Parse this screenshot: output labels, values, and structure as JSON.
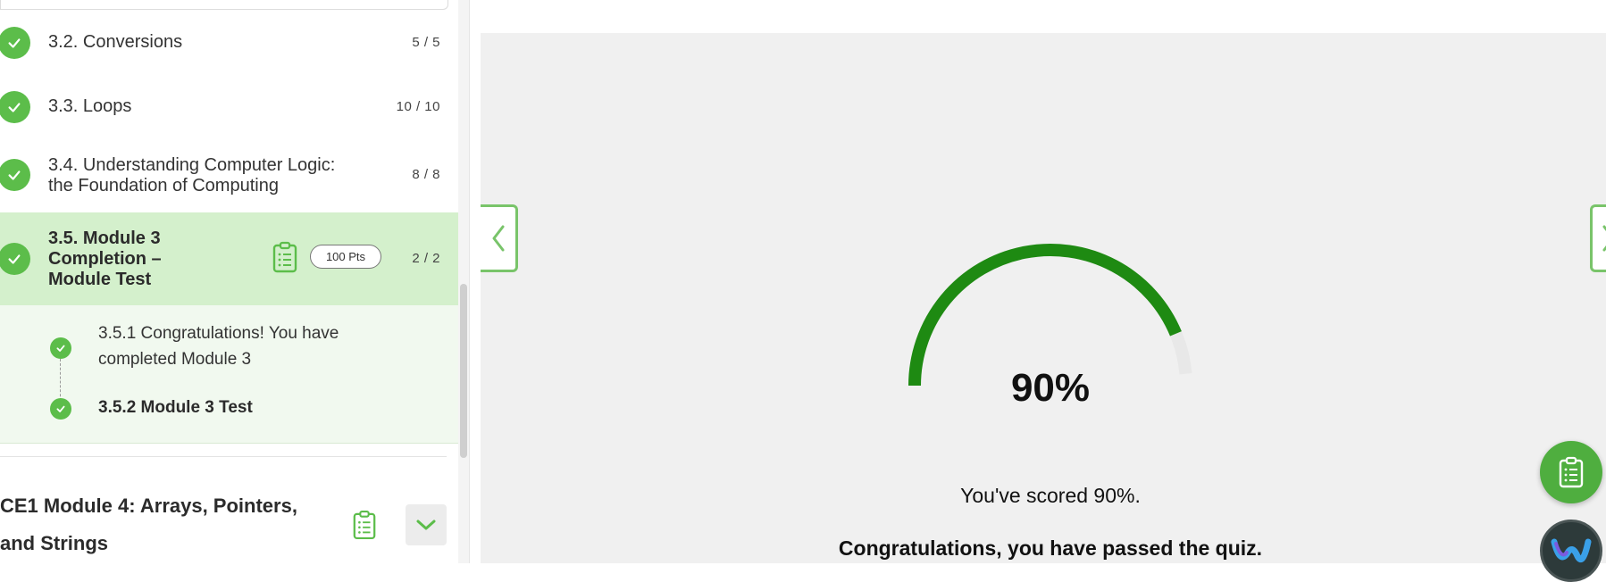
{
  "sidebar": {
    "lessons": [
      {
        "title": "3.2. Conversions",
        "count": "5 / 5"
      },
      {
        "title": "3.3. Loops",
        "count": "10 / 10"
      },
      {
        "title_line1": "3.4. Understanding Computer Logic:",
        "title_line2": "the Foundation of Computing",
        "count": "8 / 8"
      }
    ],
    "active": {
      "title_line1": "3.5. Module 3",
      "title_line2": "Completion –",
      "title_line3": "Module Test",
      "points": "100 Pts",
      "count": "2 / 2"
    },
    "sub_items": [
      {
        "line1": "3.5.1 Congratulations! You have",
        "line2": "completed Module 3"
      },
      {
        "title": "3.5.2 Module 3 Test"
      }
    ],
    "next_module": {
      "line1": "CE1 Module 4: Arrays, Pointers,",
      "line2": "and Strings"
    }
  },
  "quiz_result": {
    "percent_label": "90%",
    "score": 0.9,
    "score_text": "You've scored 90%.",
    "message": "Congratulations, you have passed the quiz."
  },
  "colors": {
    "success_green": "#5cbd4a",
    "gauge_green": "#1e8a12",
    "active_row": "#d4f0cc",
    "sub_panel": "#f1f9ef",
    "main_bg": "#f0f0f0"
  },
  "icons": [
    "check-icon",
    "clipboard-icon",
    "chevron-left-icon",
    "chevron-right-icon",
    "chevron-down-icon",
    "assistant-icon"
  ]
}
